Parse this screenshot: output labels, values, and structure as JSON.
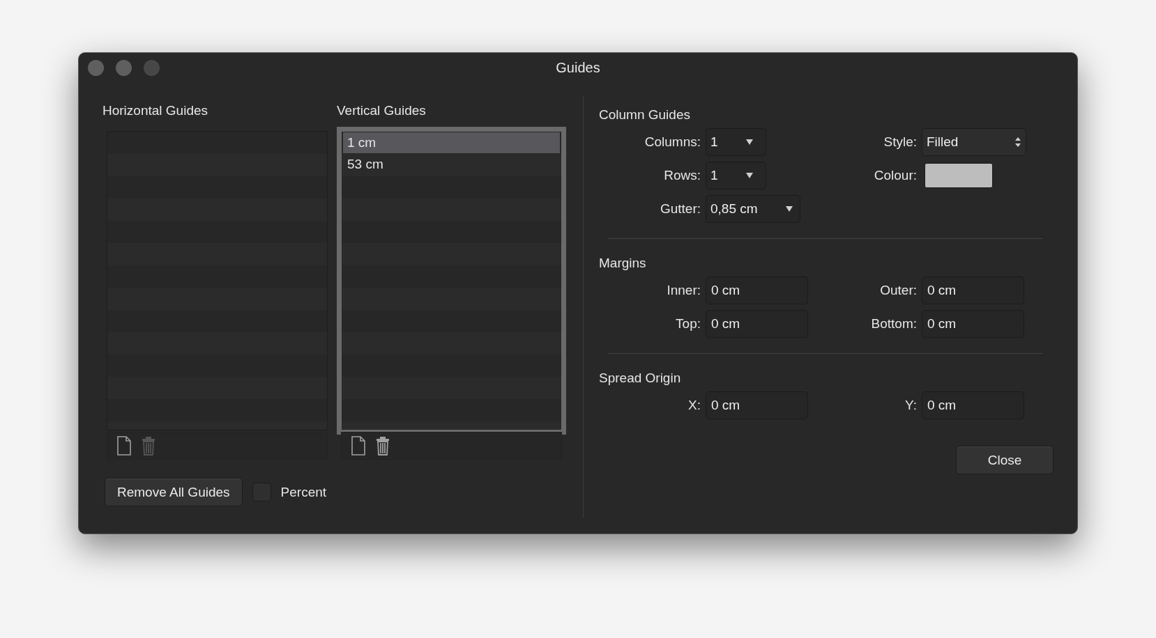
{
  "window": {
    "title": "Guides"
  },
  "guide_lists": [
    {
      "label": "Horizontal Guides",
      "focused": false
    },
    {
      "label": "Vertical Guides",
      "focused": true,
      "items": [
        {
          "text": "1 cm",
          "selected": true
        },
        {
          "text": "53 cm",
          "selected": false
        }
      ]
    }
  ],
  "remove_all_button": "Remove All Guides",
  "percent": {
    "label": "Percent",
    "checked": false
  },
  "sections": [
    {
      "title": "Column Guides",
      "rows": [
        [
          {
            "kind": "dropdown",
            "label": "Columns:",
            "value": "1"
          },
          {
            "kind": "popup",
            "label": "Style:",
            "value": "Filled"
          }
        ],
        [
          {
            "kind": "dropdown",
            "label": "Rows:",
            "value": "1"
          },
          {
            "kind": "swatch",
            "label": "Colour:",
            "color": "#bdbdbd"
          }
        ],
        [
          {
            "kind": "dropdown",
            "label": "Gutter:",
            "value": "0,85 cm"
          }
        ]
      ]
    },
    {
      "title": "Margins",
      "rows": [
        [
          {
            "kind": "text",
            "label": "Inner:",
            "value": "0 cm"
          },
          {
            "kind": "text",
            "label": "Outer:",
            "value": "0 cm"
          }
        ],
        [
          {
            "kind": "text",
            "label": "Top:",
            "value": "0 cm"
          },
          {
            "kind": "text",
            "label": "Bottom:",
            "value": "0 cm"
          }
        ]
      ]
    },
    {
      "title": "Spread Origin",
      "rows": [
        [
          {
            "kind": "text",
            "label": "X:",
            "value": "0 cm"
          },
          {
            "kind": "text",
            "label": "Y:",
            "value": "0 cm"
          }
        ]
      ]
    }
  ],
  "close_button": "Close"
}
